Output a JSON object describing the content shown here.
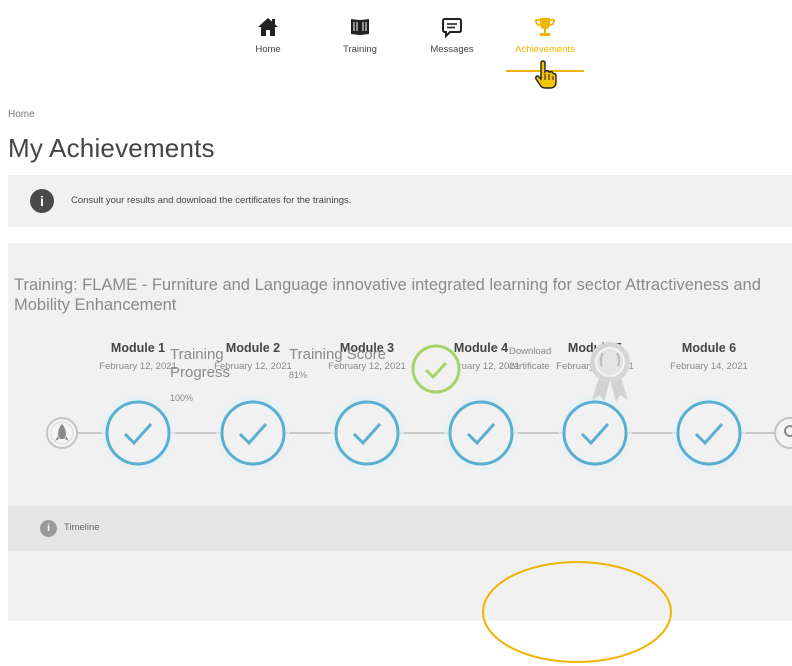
{
  "nav": {
    "items": [
      {
        "label": "Home",
        "icon": "home-icon"
      },
      {
        "label": "Training",
        "icon": "book-icon"
      },
      {
        "label": "Messages",
        "icon": "message-icon"
      },
      {
        "label": "Achievements",
        "icon": "trophy-icon",
        "active": true
      }
    ],
    "accent_color": "#f0b400"
  },
  "breadcrumb": "Home",
  "page_title": "My Achievements",
  "info_banner": {
    "icon": "i",
    "text": "Consult your results and download the certificates for the trainings."
  },
  "training": {
    "title": "Training: FLAME - Furniture and Language innovative integrated learning for sector Attractiveness and Mobility Enhancement",
    "modules": [
      {
        "name": "Module 1",
        "date": "February 12, 2021",
        "status": "completed"
      },
      {
        "name": "Module 2",
        "date": "February 12, 2021",
        "status": "completed"
      },
      {
        "name": "Module 3",
        "date": "February 12, 2021",
        "status": "completed"
      },
      {
        "name": "Module 4",
        "date": "February 12, 2021",
        "status": "completed"
      },
      {
        "name": "Module 5",
        "date": "February 14, 2021",
        "status": "completed"
      },
      {
        "name": "Module 6",
        "date": "February 14, 2021",
        "status": "completed"
      }
    ],
    "timeline_label": "Timeline",
    "progress_label": "Training Progress",
    "progress_value": "100%",
    "score_label": "Training Score",
    "score_value": "81%",
    "download_label": "Download certificate",
    "colors": {
      "check": "#5aaed0",
      "score_check": "#a8d36a",
      "highlight": "#f0b400"
    }
  }
}
